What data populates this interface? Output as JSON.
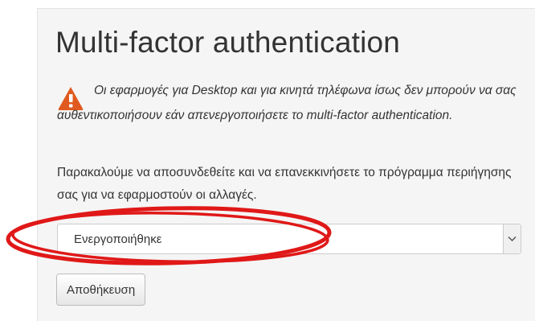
{
  "title": "Multi-factor authentication",
  "warning": {
    "text": "Οι εφαρμογές για Desktop και για κινητά τηλέφωνα ίσως δεν μπορούν να σας αυθεντικοποιήσουν εάν απενεργοποιήσετε το multi-factor authentication.",
    "icon": "warning-triangle-icon",
    "icon_color": "#e05a1f"
  },
  "instruction": "Παρακαλούμε να αποσυνδεθείτε και να επανεκκινήσετε το πρόγραμμα περιήγησης σας για να εφαρμοστούν οι αλλαγές.",
  "mfa_select": {
    "selected": "Ενεργοποιήθηκε"
  },
  "save_label": "Αποθήκευση",
  "annotation": {
    "shape": "ellipse",
    "color": "#e01818"
  }
}
